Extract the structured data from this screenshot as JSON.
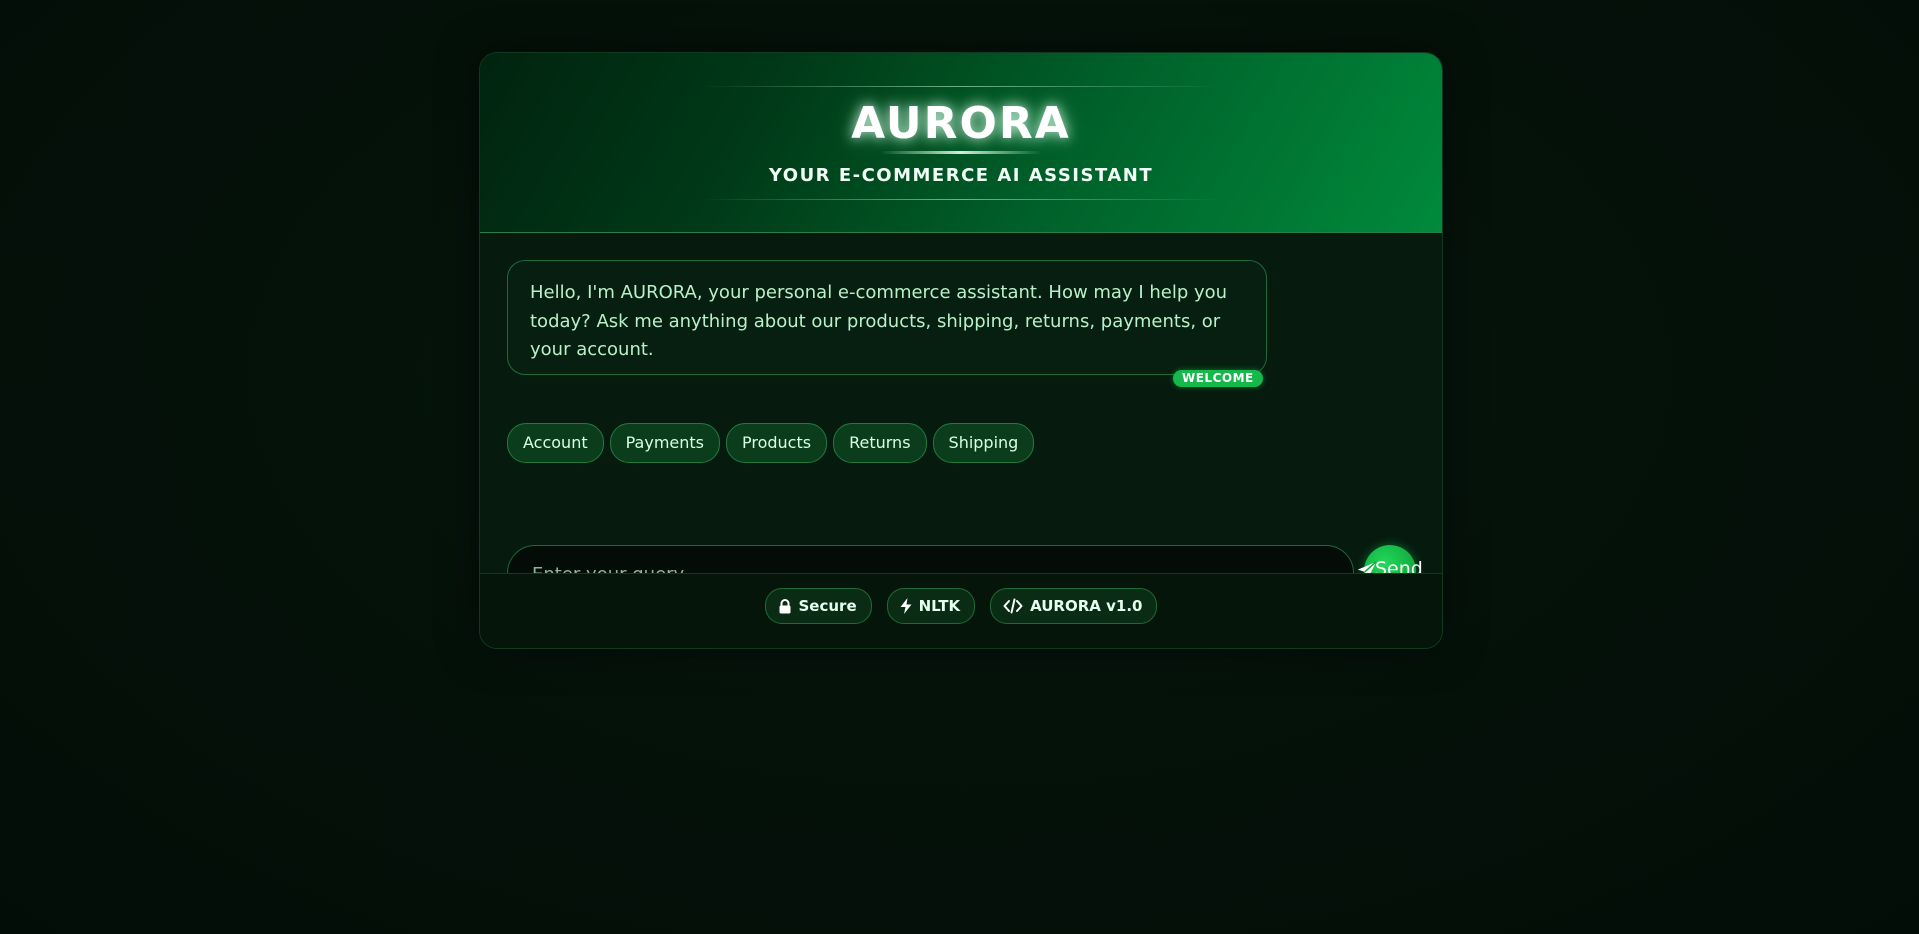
{
  "header": {
    "title": "AURORA",
    "subtitle": "YOUR E-COMMERCE AI ASSISTANT"
  },
  "chat": {
    "welcome_message": "Hello, I'm AURORA, your personal e-commerce assistant. How may I help you today? Ask me anything about our products, shipping, returns, payments, or your account.",
    "welcome_badge": "WELCOME"
  },
  "quick_replies": [
    "Account",
    "Payments",
    "Products",
    "Returns",
    "Shipping"
  ],
  "input": {
    "placeholder": "Enter your query...",
    "value": ""
  },
  "send_button": {
    "label": "Send",
    "icon": "paper-plane-icon"
  },
  "footer": {
    "badges": [
      {
        "label": "Secure",
        "icon": "lock-icon"
      },
      {
        "label": "NLTK",
        "icon": "bolt-icon"
      },
      {
        "label": "AURORA v1.0",
        "icon": "code-icon"
      }
    ]
  },
  "colors": {
    "accent": "#15b84a",
    "header_gradient_start": "#01230f",
    "header_gradient_end": "#008a3c",
    "text_light_green": "#b8f0c8"
  }
}
